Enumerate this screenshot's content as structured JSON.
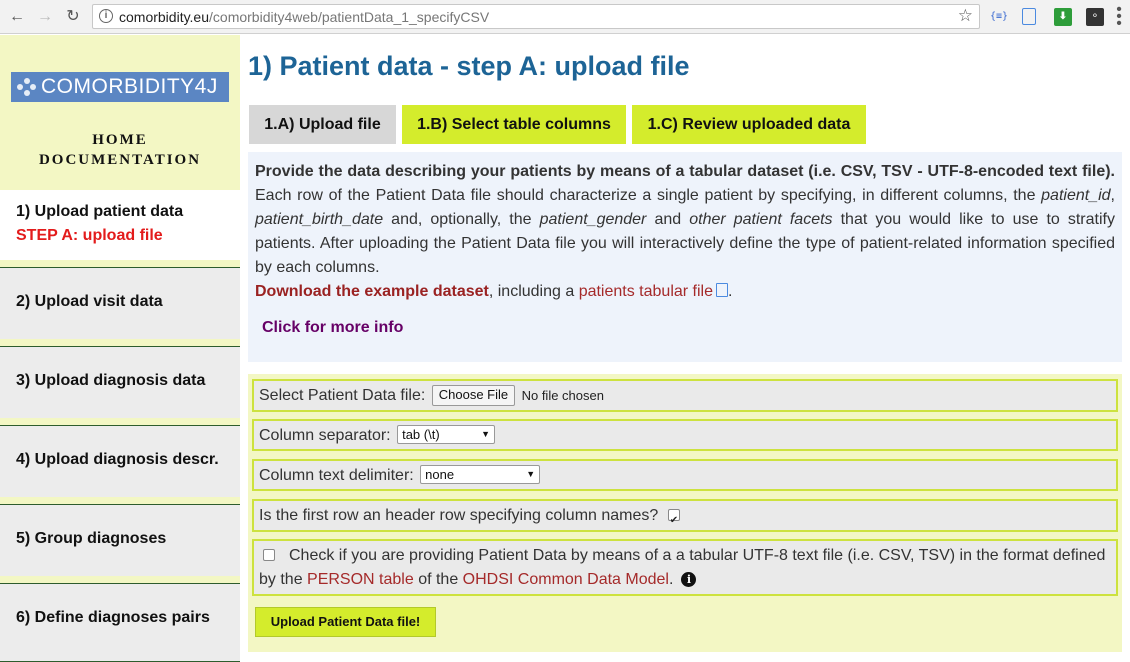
{
  "browser": {
    "url_domain": "comorbidity.eu",
    "url_path": "/comorbidity4web/patientData_1_specifyCSV",
    "nav_back": "←",
    "nav_forward": "→",
    "nav_reload": "↻",
    "star": "☆",
    "ext_json": "{≡}",
    "ext_download": "⬇",
    "ext_bulb": "💡",
    "menu": "⋮"
  },
  "sidebar": {
    "logo_text": "COMORBIDITY4J",
    "home_label": "HOME",
    "documentation_label": "DOCUMENTATION",
    "steps": [
      {
        "label": "1) Upload patient data",
        "sub": "STEP A: upload file",
        "active": true
      },
      {
        "label": "2) Upload visit data"
      },
      {
        "label": "3) Upload diagnosis data"
      },
      {
        "label": "4) Upload diagnosis descr."
      },
      {
        "label": "5) Group diagnoses"
      },
      {
        "label": "6) Define diagnoses pairs"
      }
    ]
  },
  "main": {
    "title": "1) Patient data - step A: upload file",
    "tabs": [
      {
        "label": "1.A) Upload file",
        "active": true
      },
      {
        "label": "1.B) Select table columns"
      },
      {
        "label": "1.C) Review uploaded data"
      }
    ],
    "info": {
      "lead": "Provide the data describing your patients by means of a tabular dataset (i.e. CSV, TSV - UTF-8-encoded text file).",
      "p1_a": " Each row of the Patient Data file should characterize a single patient by specifying, in different columns, the ",
      "p1_patient_id": "patient_id",
      "p1_b": ", ",
      "p1_birth": "patient_birth_date",
      "p1_c": " and, optionally, the ",
      "p1_gender": "patient_gender",
      "p1_d": " and ",
      "p1_other": "other patient facets",
      "p1_e": " that you would like to use to stratify patients. After uploading the Patient Data file you will interactively define the type of patient-related information specified by each columns.",
      "download_bold": "Download the example dataset",
      "download_mid": ", including a ",
      "download_link": "patients tabular file",
      "download_end": ".",
      "more_info": "Click for more info"
    },
    "form": {
      "file_label": "Select Patient Data file:",
      "file_button": "Choose File",
      "file_status": "No file chosen",
      "separator_label": "Column separator:",
      "separator_value": "tab (\\t)",
      "delimiter_label": "Column text delimiter:",
      "delimiter_value": "none",
      "header_label": "Is the first row an header row specifying column names?",
      "header_checked": true,
      "omop_a": "Check if you are providing Patient Data by means of a a tabular UTF-8 text file (i.e. CSV, TSV) in the format defined by the ",
      "omop_link1": "PERSON table",
      "omop_b": " of the ",
      "omop_link2": "OHDSI Common Data Model",
      "omop_c": ".",
      "omop_checked": false,
      "submit_label": "Upload Patient Data file!"
    }
  }
}
